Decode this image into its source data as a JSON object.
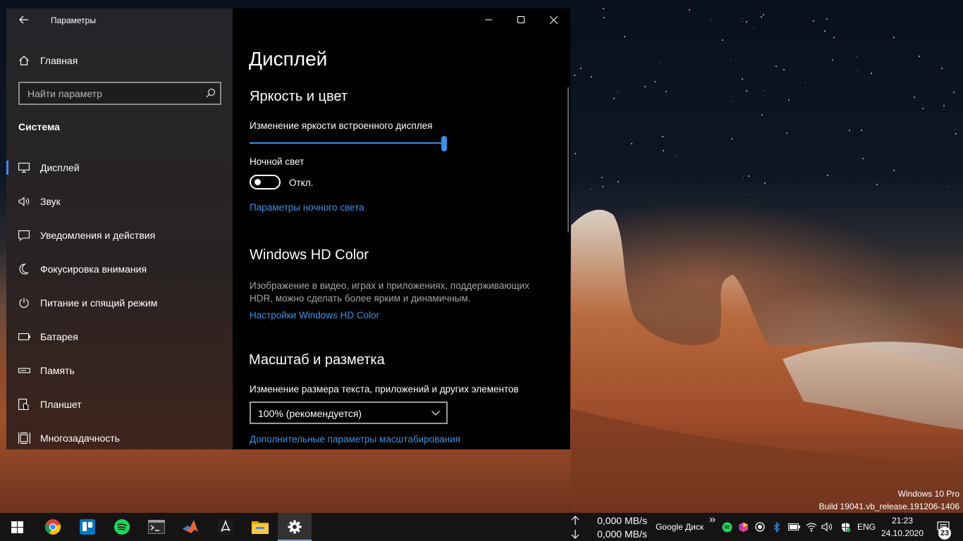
{
  "window": {
    "title": "Параметры",
    "back_icon": "back-arrow-icon"
  },
  "sidebar": {
    "home_label": "Главная",
    "search_placeholder": "Найти параметр",
    "section": "Система",
    "items": [
      {
        "label": "Дисплей",
        "icon": "monitor-icon",
        "active": true
      },
      {
        "label": "Звук",
        "icon": "speaker-icon"
      },
      {
        "label": "Уведомления и действия",
        "icon": "notification-icon"
      },
      {
        "label": "Фокусировка внимания",
        "icon": "moon-icon"
      },
      {
        "label": "Питание и спящий режим",
        "icon": "power-icon"
      },
      {
        "label": "Батарея",
        "icon": "battery-icon"
      },
      {
        "label": "Память",
        "icon": "storage-icon"
      },
      {
        "label": "Планшет",
        "icon": "tablet-icon"
      },
      {
        "label": "Многозадачность",
        "icon": "multitasking-icon"
      }
    ]
  },
  "main": {
    "title": "Дисплей",
    "brightness": {
      "heading": "Яркость и цвет",
      "slider_label": "Изменение яркости встроенного дисплея",
      "slider_value": 1.0,
      "night_light_label": "Ночной свет",
      "night_light_state": "Откл.",
      "night_light_link": "Параметры ночного света"
    },
    "hdr": {
      "heading": "Windows HD Color",
      "description_line1": "Изображение в видео, играх и приложениях, поддерживающих",
      "description_line2": "HDR, можно сделать более ярким и динамичным.",
      "link": "Настройки Windows HD Color"
    },
    "scale": {
      "heading": "Масштаб и разметка",
      "label": "Изменение размера текста, приложений и других элементов",
      "selected": "100% (рекомендуется)",
      "link": "Дополнительные параметры масштабирования"
    }
  },
  "watermark": {
    "line1": "Windows 10 Pro",
    "line2": "Build 19041.vb_release.191206-1406"
  },
  "taskbar": {
    "apps": [
      "start-icon",
      "chrome-icon",
      "trello-icon",
      "spotify-icon",
      "terminal-icon",
      "matlab-icon",
      "acrobat-icon",
      "file-explorer-icon",
      "settings-icon"
    ],
    "net_up": "0,000 MB/s",
    "net_down": "0,000 MB/s",
    "google_drive": "Google Диск",
    "language": "ENG",
    "time": "21:23",
    "date": "24.10.2020",
    "notification_count": "23"
  },
  "colors": {
    "accent": "#3a8ee6",
    "link": "#3a92e8"
  }
}
